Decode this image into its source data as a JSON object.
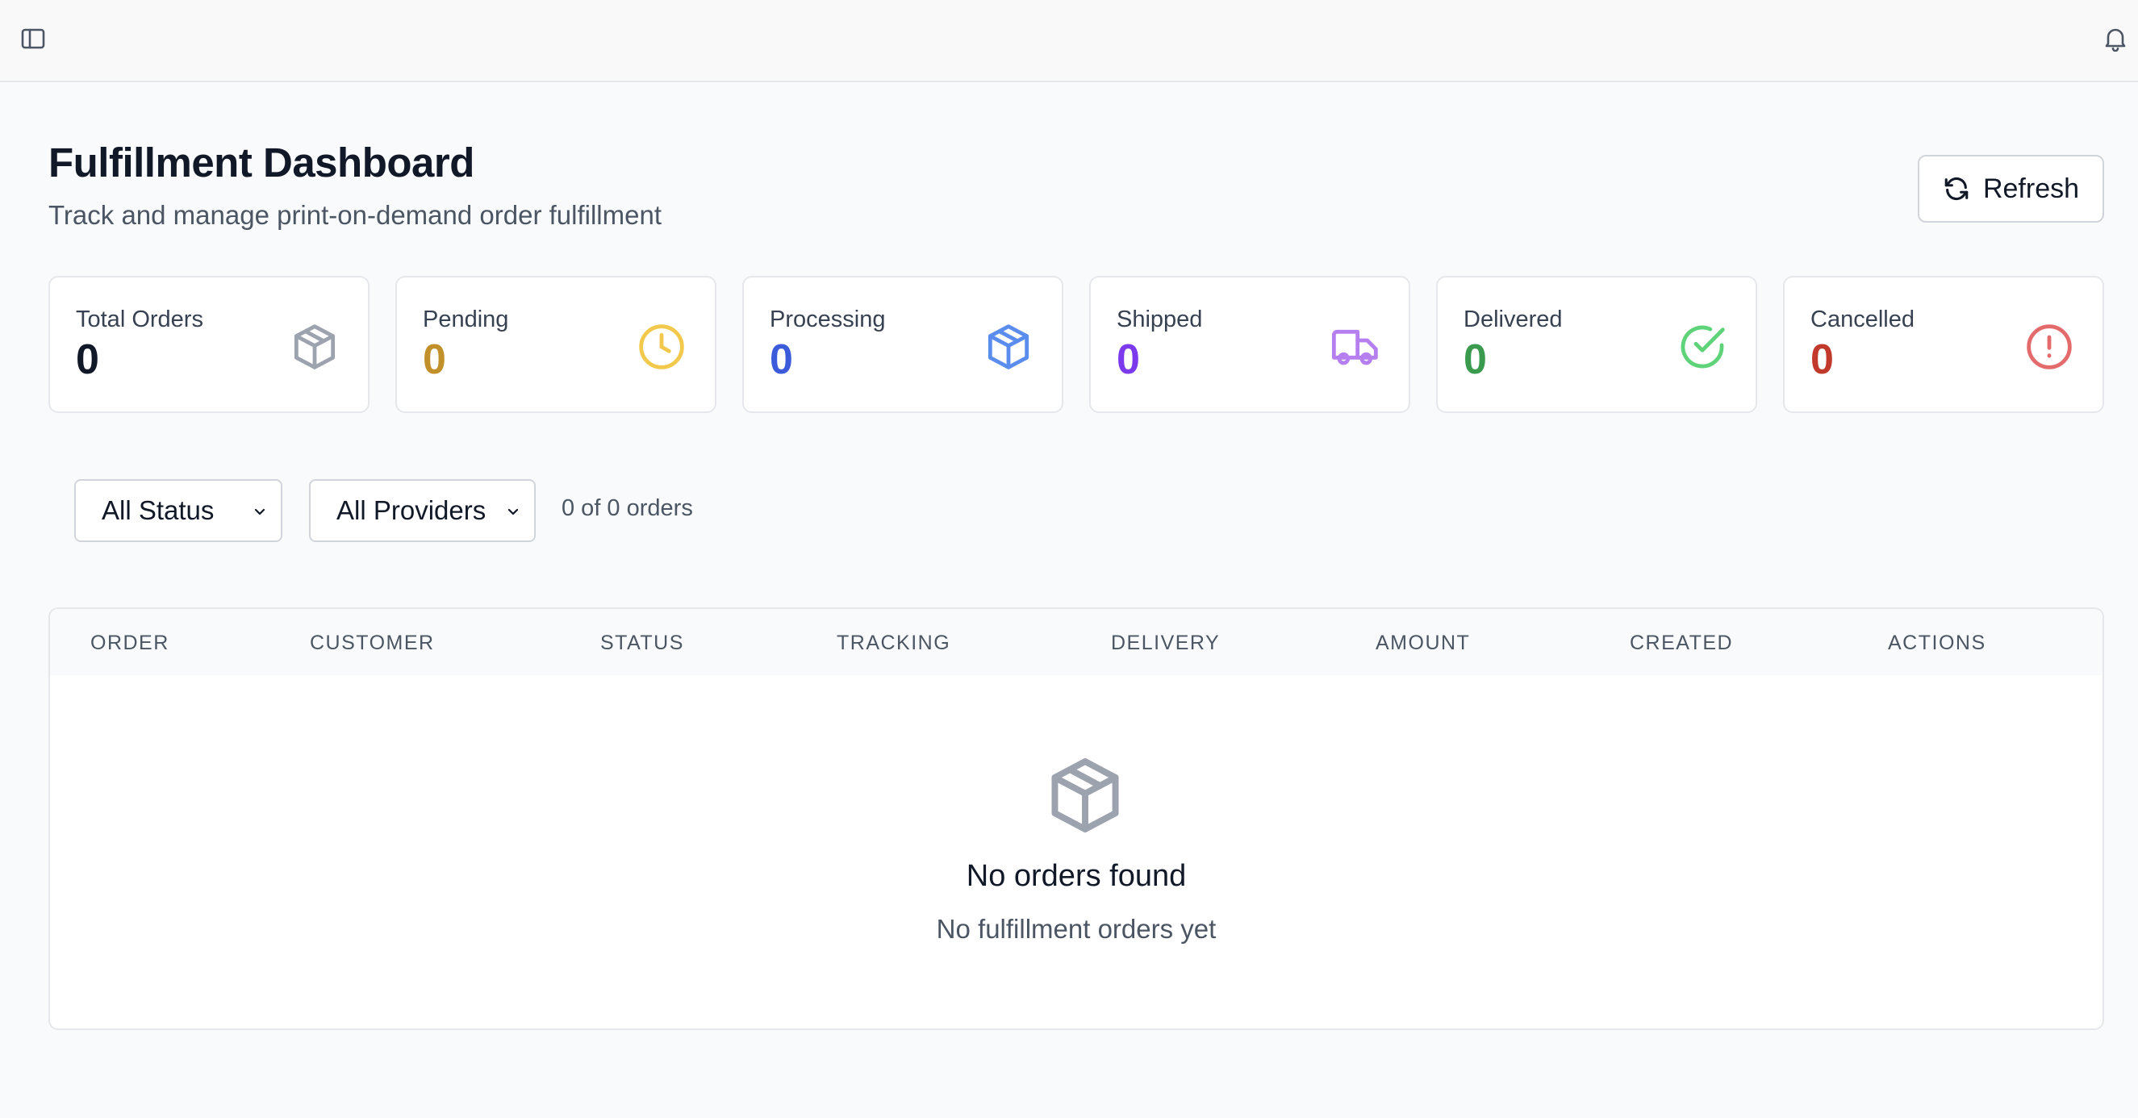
{
  "header": {
    "sidebar_toggle_icon": "panel-left-icon",
    "notifications_icon": "bell-icon"
  },
  "page": {
    "title": "Fulfillment Dashboard",
    "subtitle": "Track and manage print-on-demand order fulfillment",
    "refresh_label": "Refresh",
    "refresh_icon": "refresh-icon"
  },
  "stats": [
    {
      "label": "Total Orders",
      "value": "0",
      "icon": "package-icon",
      "value_color": "#111827",
      "icon_color": "#9ca3af"
    },
    {
      "label": "Pending",
      "value": "0",
      "icon": "clock-icon",
      "value_color": "#c2902a",
      "icon_color": "#f2c94c"
    },
    {
      "label": "Processing",
      "value": "0",
      "icon": "package-icon",
      "value_color": "#3b5bdb",
      "icon_color": "#5b8def"
    },
    {
      "label": "Shipped",
      "value": "0",
      "icon": "truck-icon",
      "value_color": "#7c3aed",
      "icon_color": "#b57ff0"
    },
    {
      "label": "Delivered",
      "value": "0",
      "icon": "check-circle-icon",
      "value_color": "#3a9a4e",
      "icon_color": "#5fd37a"
    },
    {
      "label": "Cancelled",
      "value": "0",
      "icon": "alert-circle-icon",
      "value_color": "#c0392b",
      "icon_color": "#e46b6b"
    }
  ],
  "filters": {
    "status_selected": "All Status",
    "provider_selected": "All Providers",
    "count_text": "0 of 0 orders"
  },
  "table": {
    "columns": [
      "ORDER",
      "CUSTOMER",
      "STATUS",
      "TRACKING",
      "DELIVERY",
      "AMOUNT",
      "CREATED",
      "ACTIONS"
    ],
    "rows": [],
    "empty_icon": "package-icon",
    "empty_title": "No orders found",
    "empty_subtitle": "No fulfillment orders yet"
  }
}
